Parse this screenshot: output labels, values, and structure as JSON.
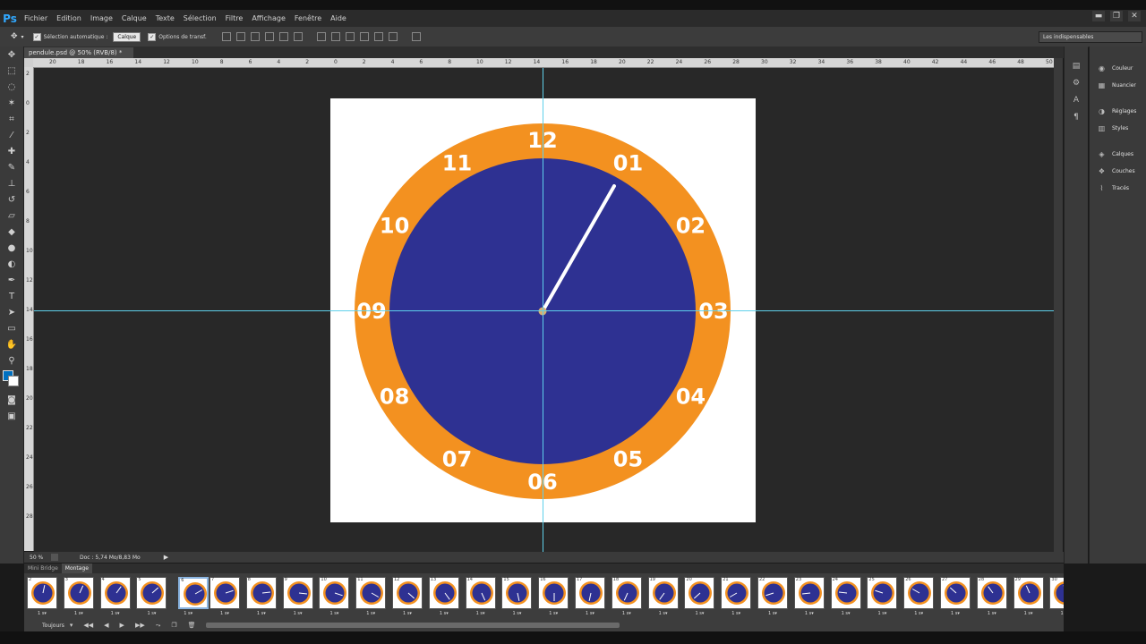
{
  "app": {
    "logo": "Ps"
  },
  "menu": [
    "Fichier",
    "Edition",
    "Image",
    "Calque",
    "Texte",
    "Sélection",
    "Filtre",
    "Affichage",
    "Fenêtre",
    "Aide"
  ],
  "window_controls": {
    "minimize": "▬",
    "restore": "❐",
    "close": "✕"
  },
  "options_bar": {
    "auto_select_label": "Sélection automatique :",
    "auto_select_value": "Calque",
    "transform_label": "Options de transf."
  },
  "workspace": "Les indispensables",
  "document_tab": "pendule.psd @ 50% (RVB/8) *",
  "ruler_h": [
    "20",
    "18",
    "16",
    "14",
    "12",
    "10",
    "8",
    "6",
    "4",
    "2",
    "0",
    "2",
    "4",
    "6",
    "8",
    "10",
    "12",
    "14",
    "16",
    "18",
    "20",
    "22",
    "24",
    "26",
    "28",
    "30",
    "32",
    "34",
    "36",
    "38",
    "40",
    "42",
    "44",
    "46",
    "48",
    "50"
  ],
  "ruler_v": [
    "2",
    "0",
    "2",
    "4",
    "6",
    "8",
    "10",
    "12",
    "14",
    "16",
    "18",
    "20",
    "22",
    "24",
    "26",
    "28"
  ],
  "clock": {
    "numbers": [
      "12",
      "01",
      "02",
      "03",
      "04",
      "05",
      "06",
      "07",
      "08",
      "09",
      "10",
      "11"
    ],
    "ring_color": "#f39120",
    "face_color": "#2e3192",
    "hand_color": "#ffffff",
    "hand_position": 1
  },
  "status": {
    "zoom": "50 %",
    "doc": "Doc : 5,74 Mo/8,83 Mo"
  },
  "right_panels": [
    {
      "icon": "color-icon",
      "label": "Couleur"
    },
    {
      "icon": "swatches-icon",
      "label": "Nuancier"
    },
    {
      "icon": "adjustments-icon",
      "label": "Réglages"
    },
    {
      "icon": "styles-icon",
      "label": "Styles"
    },
    {
      "icon": "layers-icon",
      "label": "Calques"
    },
    {
      "icon": "channels-icon",
      "label": "Couches"
    },
    {
      "icon": "paths-icon",
      "label": "Tracés"
    }
  ],
  "timeline": {
    "tabs": [
      "Mini Bridge",
      "Montage"
    ],
    "active_tab": "Montage",
    "frames": [
      "2",
      "3",
      "4",
      "5",
      "6",
      "7",
      "8",
      "9",
      "10",
      "11",
      "12",
      "13",
      "14",
      "15",
      "16",
      "17",
      "18",
      "19",
      "20",
      "21",
      "22",
      "23",
      "24",
      "25",
      "26",
      "27",
      "28",
      "29",
      "30"
    ],
    "selected_frame": "6",
    "delay": "1 s",
    "loop": "Toujours"
  }
}
